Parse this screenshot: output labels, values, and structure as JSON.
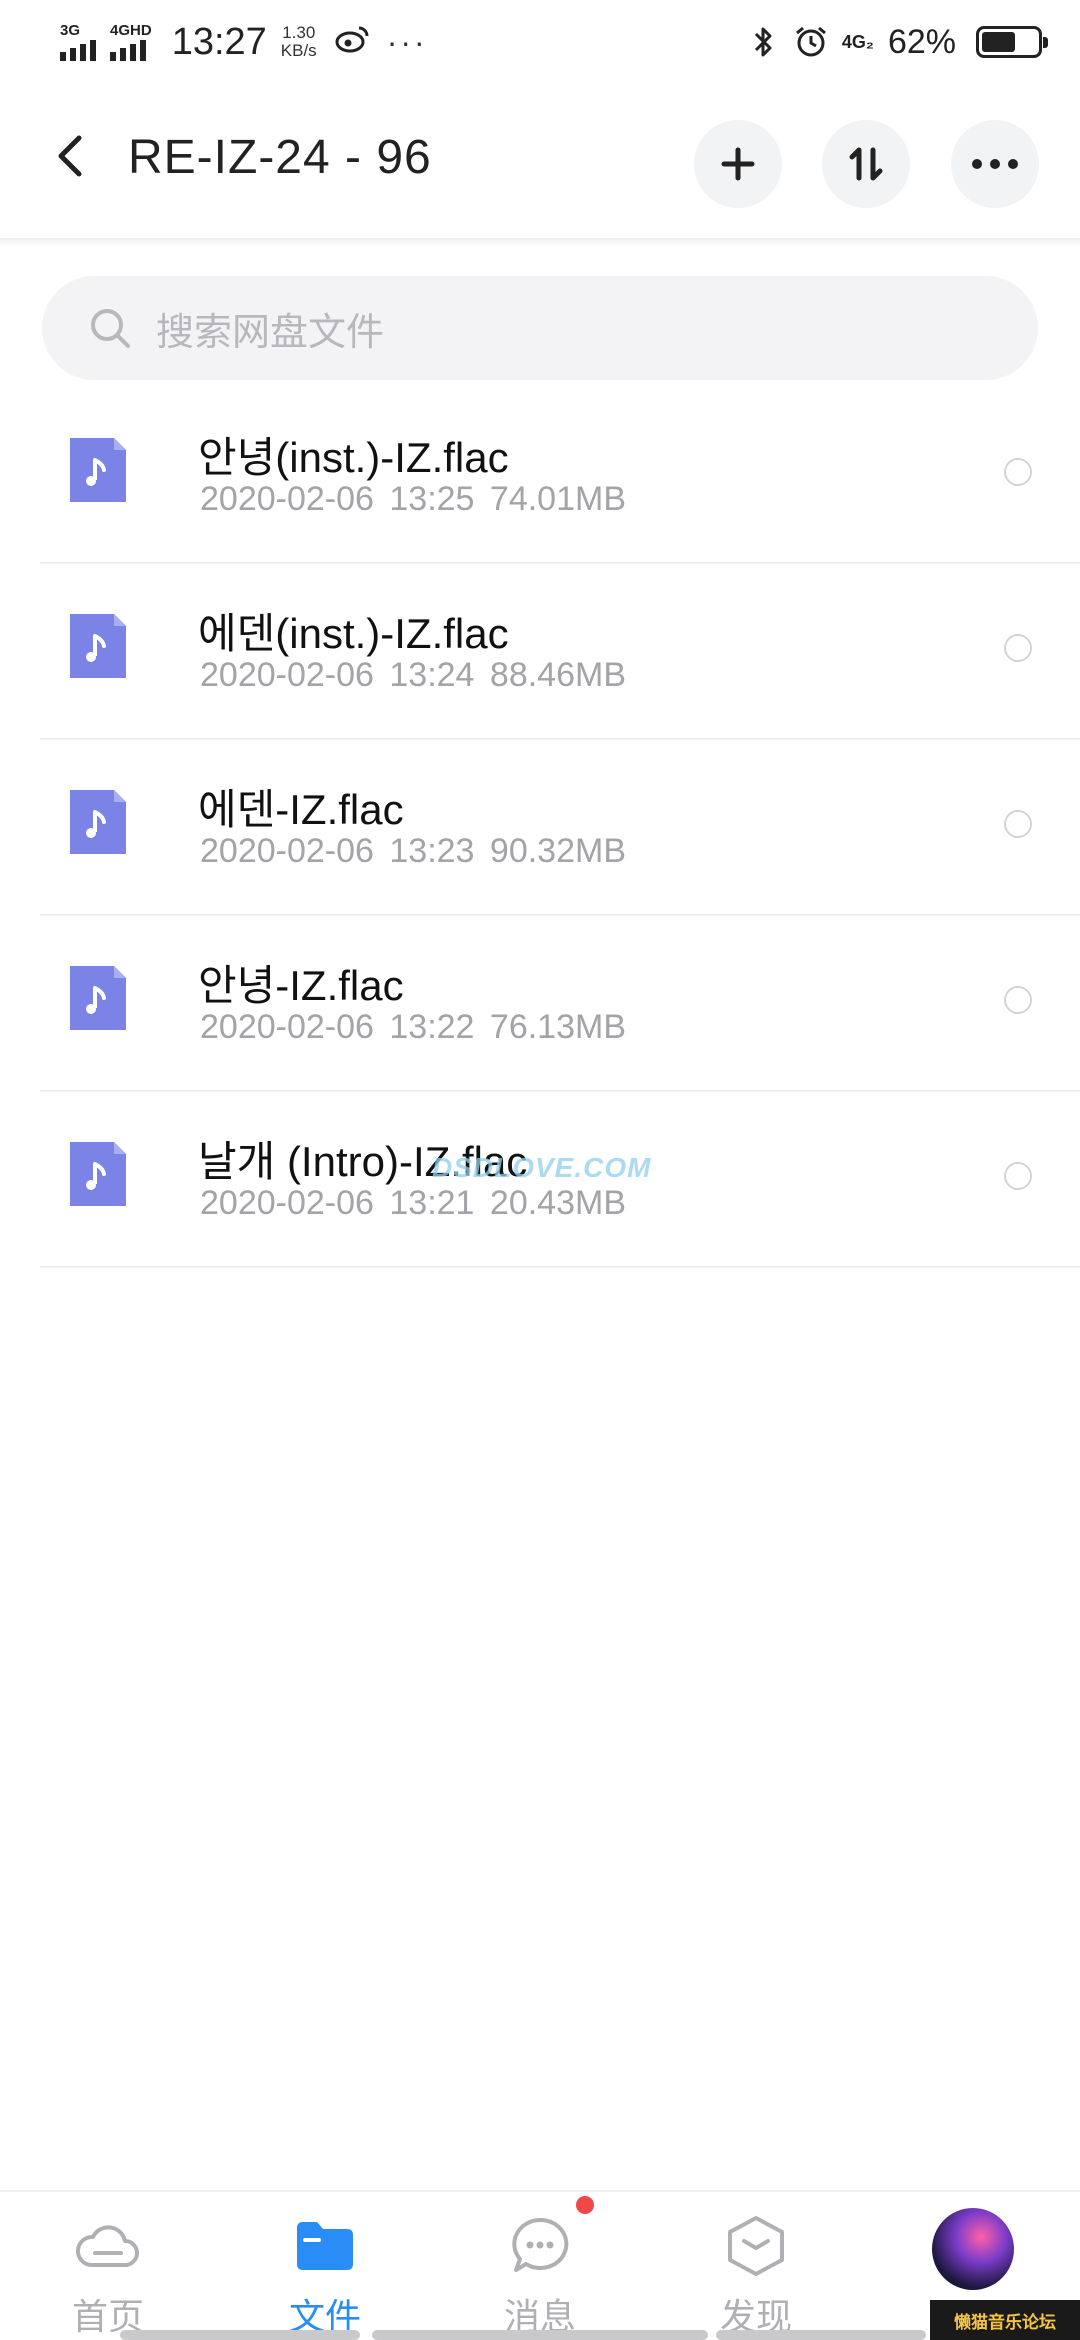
{
  "status_bar": {
    "signal1_label": "3G",
    "signal2_label": "4GHD",
    "time": "13:27",
    "speed_value": "1.30",
    "speed_unit": "KB/s",
    "more_dots": "···",
    "network_label": "4G₂",
    "battery_percent": "62%",
    "battery_level": 0.62
  },
  "header": {
    "title": "RE-IZ-24 - 96",
    "back_icon": "chevron-left-icon",
    "add_icon": "plus-icon",
    "sort_icon": "sort-arrows-icon",
    "more_icon": "more-horizontal-icon"
  },
  "search": {
    "placeholder": "搜索网盘文件"
  },
  "files": [
    {
      "name": "안녕(inst.)-IZ.flac",
      "date": "2020-02-06",
      "time": "13:25",
      "size": "74.01MB"
    },
    {
      "name": "에덴(inst.)-IZ.flac",
      "date": "2020-02-06",
      "time": "13:24",
      "size": "88.46MB"
    },
    {
      "name": "에덴-IZ.flac",
      "date": "2020-02-06",
      "time": "13:23",
      "size": "90.32MB"
    },
    {
      "name": "안녕-IZ.flac",
      "date": "2020-02-06",
      "time": "13:22",
      "size": "76.13MB"
    },
    {
      "name": "날개 (Intro)-IZ.flac",
      "date": "2020-02-06",
      "time": "13:21",
      "size": "20.43MB"
    }
  ],
  "watermark": "DSDLOVE.COM",
  "bottom_nav": {
    "items": [
      {
        "label": "首页",
        "icon": "cloud-icon"
      },
      {
        "label": "文件",
        "icon": "folder-icon",
        "active": true
      },
      {
        "label": "消息",
        "icon": "chat-bubble-icon",
        "badge": true
      },
      {
        "label": "发现",
        "icon": "cube-icon"
      }
    ]
  },
  "forum_tag": "懒猫音乐论坛",
  "colors": {
    "accent": "#2a8df5",
    "file_icon": "#7c83e6",
    "badge": "#f04848"
  }
}
